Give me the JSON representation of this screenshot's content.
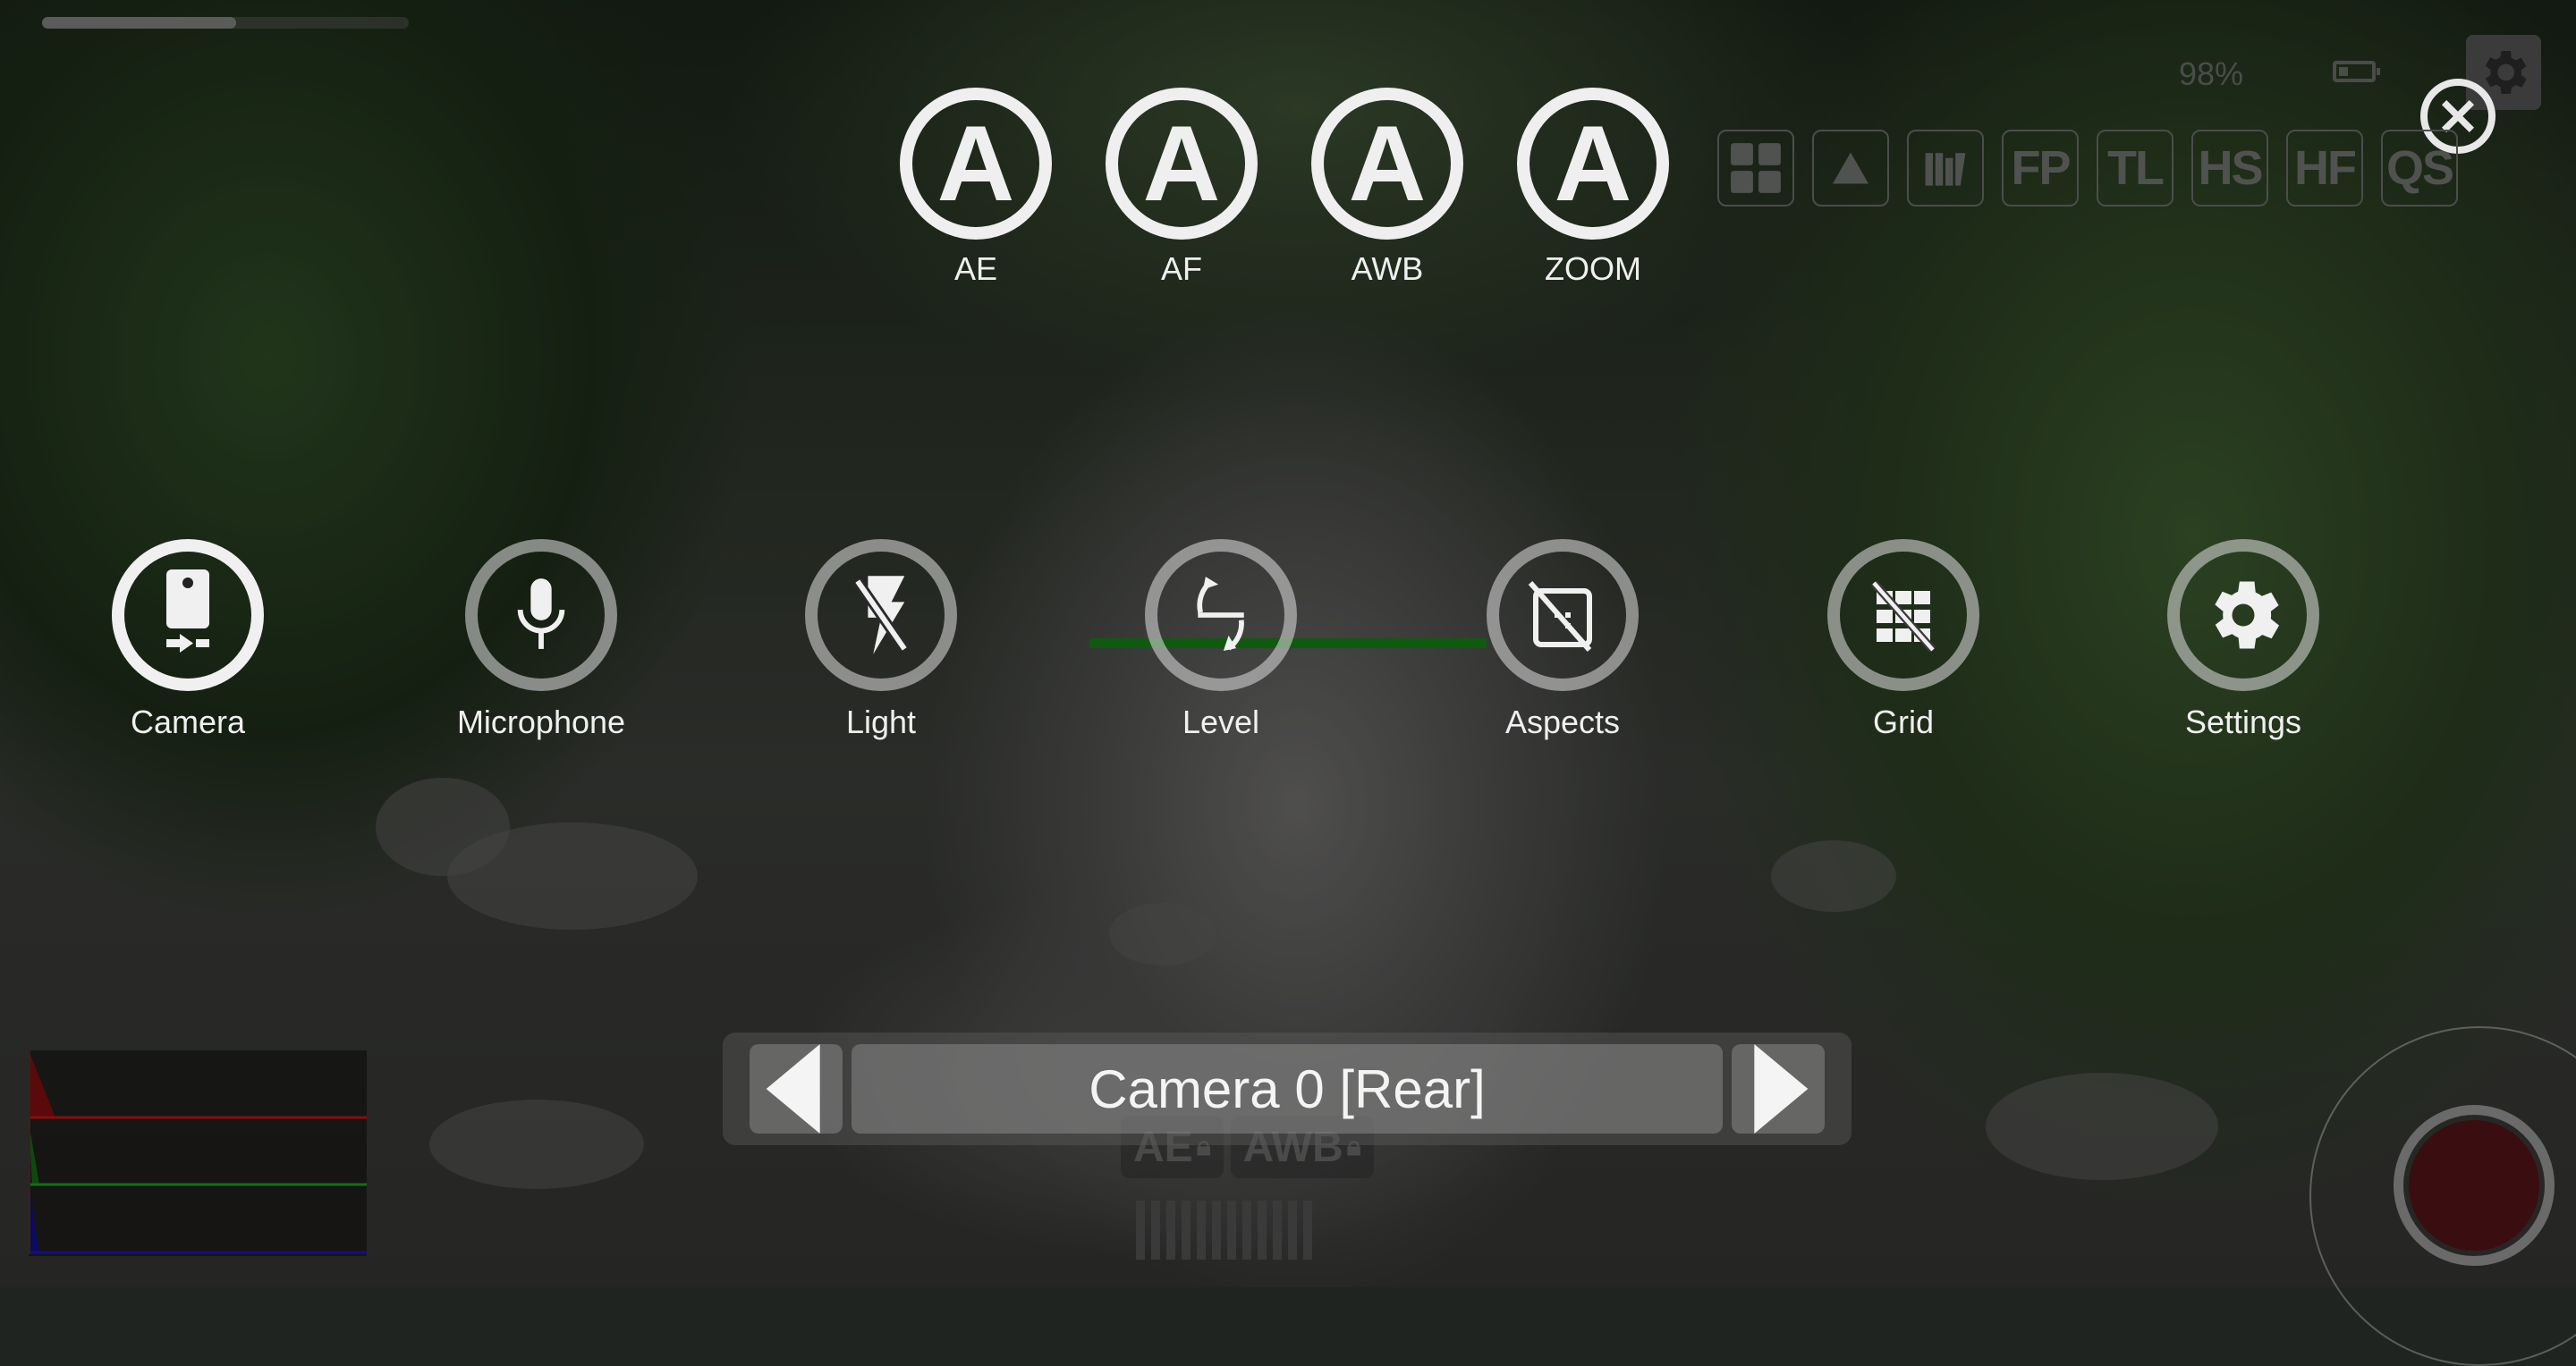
{
  "status": {
    "battery_percent": "98%",
    "recording_progress": 0.53
  },
  "auto_controls": [
    {
      "id": "ae",
      "glyph": "A",
      "label": "AE"
    },
    {
      "id": "af",
      "glyph": "A",
      "label": "AF"
    },
    {
      "id": "awb",
      "glyph": "A",
      "label": "AWB"
    },
    {
      "id": "zoom",
      "glyph": "A",
      "label": "ZOOM"
    }
  ],
  "quick_toolbar": [
    {
      "id": "grid-layout",
      "text": "",
      "icon": "grid-layout-icon"
    },
    {
      "id": "exposure",
      "text": "",
      "icon": "triangle-icon"
    },
    {
      "id": "focus-peaking-bars",
      "text": "",
      "icon": "bars-icon"
    },
    {
      "id": "fp",
      "text": "FP"
    },
    {
      "id": "tl",
      "text": "TL"
    },
    {
      "id": "hs",
      "text": "HS"
    },
    {
      "id": "hf",
      "text": "HF"
    },
    {
      "id": "qs",
      "text": "QS"
    }
  ],
  "main_menu": [
    {
      "id": "camera",
      "label": "Camera",
      "active": true
    },
    {
      "id": "microphone",
      "label": "Microphone",
      "active": false
    },
    {
      "id": "light",
      "label": "Light",
      "active": false
    },
    {
      "id": "level",
      "label": "Level",
      "active": false
    },
    {
      "id": "aspects",
      "label": "Aspects",
      "active": false
    },
    {
      "id": "grid",
      "label": "Grid",
      "active": false
    },
    {
      "id": "settings",
      "label": "Settings",
      "active": false
    }
  ],
  "camera_selector": {
    "current": "Camera 0 [Rear]"
  },
  "locks": {
    "ae_lock": "AE",
    "awb_lock": "AWB"
  },
  "colors": {
    "icon_white": "#efefef",
    "level_indicator": "#0f5a0f",
    "record_button": "#3a0d10",
    "histogram_red": "#8a0d0d",
    "histogram_green": "#137013",
    "histogram_blue": "#101080"
  }
}
